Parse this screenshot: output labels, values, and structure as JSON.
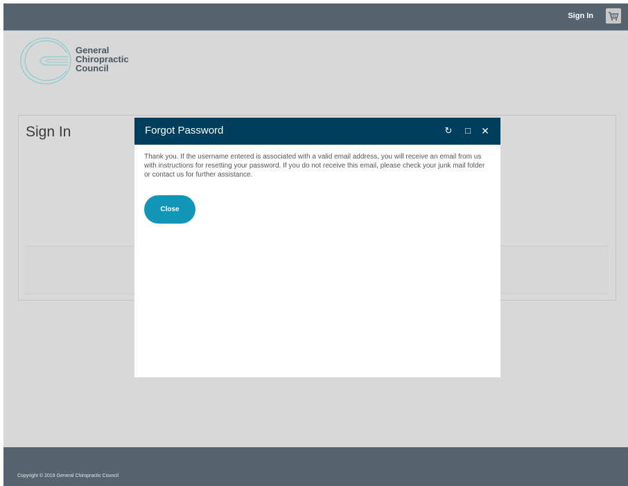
{
  "header": {
    "signin_label": "Sign In",
    "cart_icon": "cart-icon"
  },
  "logo": {
    "line1": "General",
    "line2": "Chiropractic",
    "line3": "Council",
    "color": "#8fcbd0"
  },
  "panel": {
    "title": "Sign In"
  },
  "modal": {
    "title": "Forgot Password",
    "refresh_icon": "↻",
    "maximize_icon": "□",
    "close_icon": "✕",
    "message": "Thank you. If the username entered is associated with a valid email address, you will receive an email from us with instructions for resetting your password. If you do not receive this email, please check your junk mail folder or contact us for further assistance.",
    "close_button_label": "Close",
    "header_color": "#003e5e",
    "button_color": "#1296b8"
  },
  "footer": {
    "copyright": "Copyright © 2019 General Chiropractic Council"
  }
}
